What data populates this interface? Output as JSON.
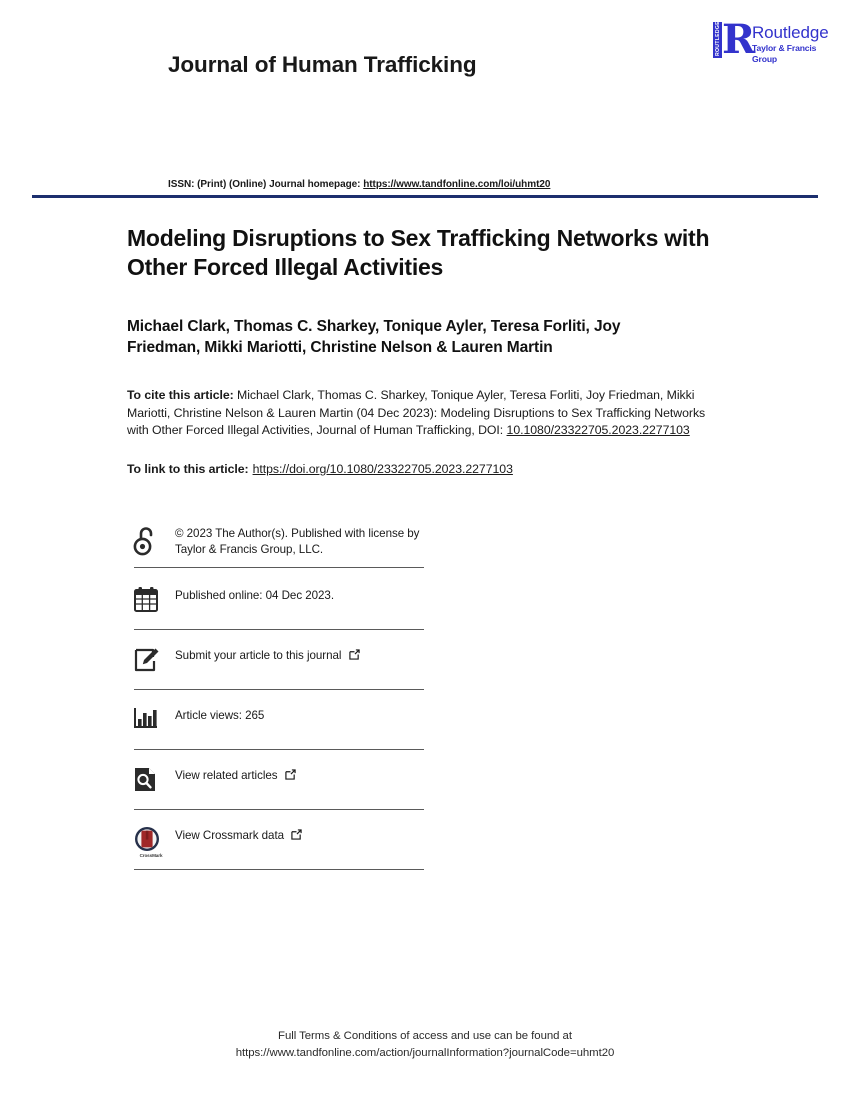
{
  "masthead": {
    "journal_title": "Journal of Human Trafficking",
    "logo": {
      "mark_text": "ROUTLEDGE",
      "letter": "R",
      "name": "Routledge",
      "subtitle": "Taylor & Francis Group",
      "color": "#3333CC"
    },
    "issn_prefix": "ISSN: (Print) (Online) Journal homepage:",
    "issn_link": "https://www.tandfonline.com/loi/uhmt20",
    "rule_color": "#1C2F6E"
  },
  "article": {
    "title": "Modeling Disruptions to Sex Trafficking Networks with Other Forced Illegal Activities",
    "authors": "Michael Clark, Thomas C. Sharkey, Tonique Ayler, Teresa Forliti, Joy Friedman, Mikki Mariotti, Christine Nelson & Lauren Martin",
    "cite_label": "To cite this article:",
    "cite_text": " Michael Clark, Thomas C. Sharkey, Tonique Ayler, Teresa Forliti, Joy Friedman, Mikki Mariotti, Christine Nelson & Lauren Martin (04 Dec 2023): Modeling Disruptions to Sex Trafficking Networks with Other Forced Illegal Activities, Journal of Human Trafficking, DOI: ",
    "cite_doi": "10.1080/23322705.2023.2277103",
    "link_label": "To link to this article:",
    "link_url": "https://doi.org/10.1080/23322705.2023.2277103"
  },
  "metadata_rows": [
    {
      "icon": "open-access-icon",
      "text": "© 2023 The Author(s). Published with license by Taylor & Francis Group, LLC.",
      "external": false
    },
    {
      "icon": "calendar-icon",
      "text": "Published online: 04 Dec 2023.",
      "external": false
    },
    {
      "icon": "pencil-submit-icon",
      "text": "Submit your article to this journal",
      "external": true
    },
    {
      "icon": "bar-chart-icon",
      "text": "Article views: 265",
      "external": false
    },
    {
      "icon": "related-articles-icon",
      "text": "View related articles",
      "external": true
    },
    {
      "icon": "crossmark-icon",
      "text": "View Crossmark data",
      "external": true,
      "badge_label": "CrossMark"
    }
  ],
  "footer": {
    "line1": "Full Terms & Conditions of access and use can be found at",
    "line2": "https://www.tandfonline.com/action/journalInformation?journalCode=uhmt20"
  }
}
